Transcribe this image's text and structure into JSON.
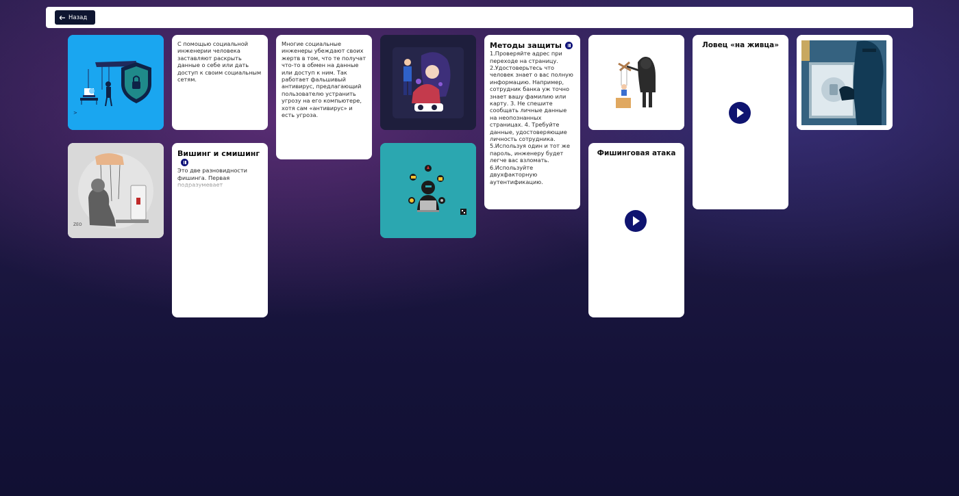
{
  "header": {
    "back_label": "Назад",
    "back_icon": "arrow-left-icon"
  },
  "cards": {
    "intro_text": "С помощью социальной инженерии человека заставляют раскрыть данные о себе или дать доступ к своим социальным сетям.",
    "antivirus_text": "Многие социальные инженеры убеждают своих жертв в том, что те получат что-то в обмен на данные или доступ к ним. Так работает фальшивый антивирус, предлагающий пользователю устранить угрозу на его компьютере, хотя сам «антивирус» и есть угроза.",
    "methods_title": "Методы защиты",
    "methods_text": "1.Проверяйте адрес при переходе на страницу. 2.Удостоверьтесь что человек знает о вас полную информацию. Например, сотрудник банка уж точно знает вашу фамилию или карту. 3. Не спешите сообщать личные данные на неопознанных страницах. 4. Требуйте данные, удостоверяющие личность сотрудника. 5.Используя один и тот же пароль, инженеру будет легче вас взломать. 6.Используйте двухфакторную аутентификацию.",
    "video1_title": "Ловец «на живца»",
    "vishing_title": "Вишинг и смишинг",
    "vishing_text": "Это две разновидности фишинга. Первая подразумевает",
    "video2_title": "Фишинговая атака",
    "image1_mark": ">",
    "image2_mark": "ZEO"
  },
  "colors": {
    "accent": "#10147a",
    "card_bg": "#ffffff",
    "back_button_bg": "#0e1530",
    "image1_bg": "#1aa6f0",
    "image5_bg": "#2ba7b0"
  }
}
